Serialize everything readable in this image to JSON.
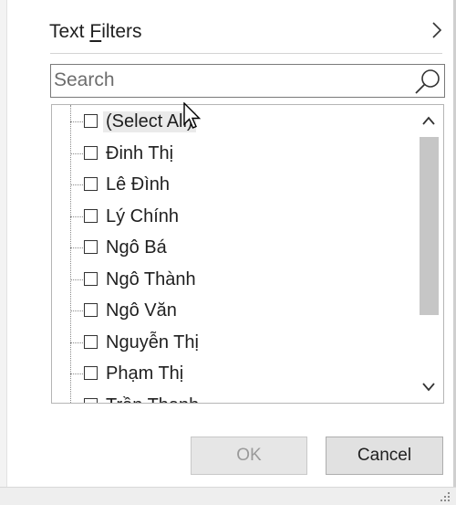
{
  "text_filters": {
    "label_pre": "Text ",
    "label_accel": "F",
    "label_post": "ilters"
  },
  "search": {
    "placeholder": "Search"
  },
  "items": [
    {
      "label": "(Select All)",
      "checked": false
    },
    {
      "label": "Đinh Thị",
      "checked": false
    },
    {
      "label": "Lê Đình",
      "checked": false
    },
    {
      "label": "Lý Chính",
      "checked": false
    },
    {
      "label": "Ngô Bá",
      "checked": false
    },
    {
      "label": "Ngô Thành",
      "checked": false
    },
    {
      "label": "Ngô Văn",
      "checked": false
    },
    {
      "label": "Nguyễn Thị",
      "checked": false
    },
    {
      "label": "Phạm Thị",
      "checked": false
    },
    {
      "label": "Trần Thanh",
      "checked": false
    }
  ],
  "buttons": {
    "ok": "OK",
    "cancel": "Cancel"
  },
  "icons": {
    "chevron": "chevron-right-icon",
    "search": "magnifier-icon",
    "scroll_up": "chevron-up-icon",
    "scroll_down": "chevron-down-icon"
  },
  "colors": {
    "ok_disabled_text": "#9a9a9a",
    "scroll_thumb": "#c6c6c6"
  }
}
